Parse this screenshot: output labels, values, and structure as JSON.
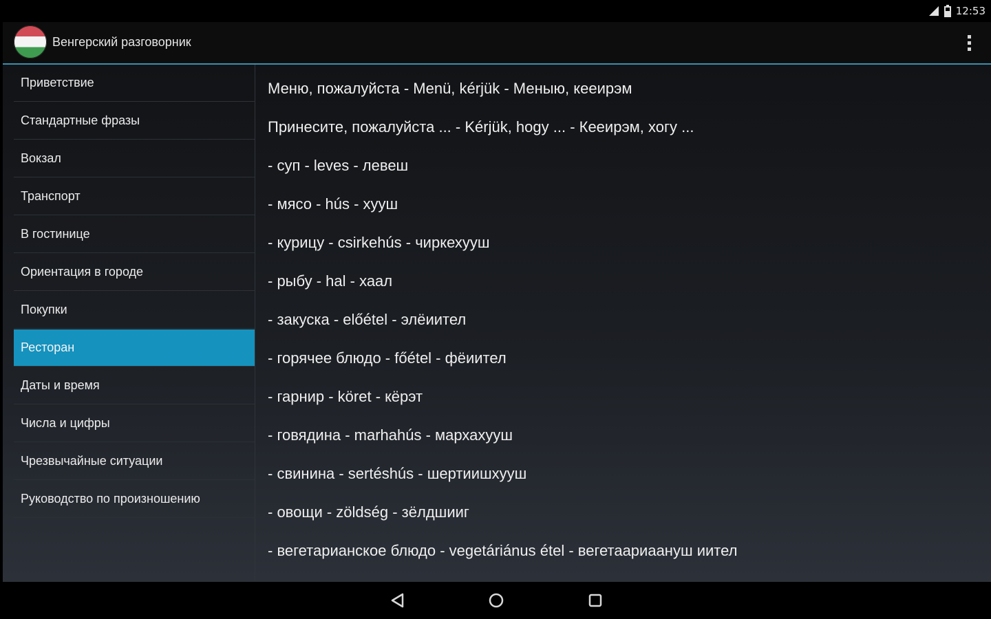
{
  "status_bar": {
    "time": "12:53",
    "icons": [
      "signal-icon",
      "battery-icon"
    ]
  },
  "action_bar": {
    "title": "Венгерский разговорник",
    "app_icon": "hungary-flag-icon",
    "overflow_icon": "overflow-menu-icon"
  },
  "colors": {
    "accent": "#1592be",
    "divider": "#3a8fb0",
    "flag_red": "#d14b56",
    "flag_white": "#f4f4f4",
    "flag_green": "#3f9b4f"
  },
  "sidebar": {
    "selected_index": 7,
    "items": [
      {
        "label": "Приветствие"
      },
      {
        "label": "Стандартные фразы"
      },
      {
        "label": "Вокзал"
      },
      {
        "label": "Транспорт"
      },
      {
        "label": "В гостинице"
      },
      {
        "label": "Ориентация в городе"
      },
      {
        "label": "Покупки"
      },
      {
        "label": "Ресторан"
      },
      {
        "label": "Даты и время"
      },
      {
        "label": "Числа и цифры"
      },
      {
        "label": "Чрезвычайные ситуации"
      },
      {
        "label": "Руководство по произношению"
      }
    ]
  },
  "phrases": [
    {
      "text": "Меню, пожалуйста - Menü, kérjük - Меныю, кеeирэм"
    },
    {
      "text": "Принесите, пожалуйста ... - Kérjük, hogy ... - Кеeирэм, хогу ..."
    },
    {
      "text": "- суп - leves - левеш"
    },
    {
      "text": "- мясо - hús - хууш"
    },
    {
      "text": "- курицу - csirkehús - чиркехууш"
    },
    {
      "text": "- рыбу - hal - хаал"
    },
    {
      "text": "- закуска - előétel - элёиител"
    },
    {
      "text": "- горячее блюдо - főétel - фёиител"
    },
    {
      "text": "- гарнир - köret - кёрэт"
    },
    {
      "text": "- говядина - marhahús - мархахууш"
    },
    {
      "text": "- свинина - sertéshús - шертиишхууш"
    },
    {
      "text": "- овощи - zöldség - зёлдшииг"
    },
    {
      "text": "- вегетарианское блюдо - vegetáriánus étel - вегетаариаануш иител"
    }
  ],
  "nav_bar": {
    "buttons": [
      "back-icon",
      "home-icon",
      "recents-icon"
    ]
  }
}
